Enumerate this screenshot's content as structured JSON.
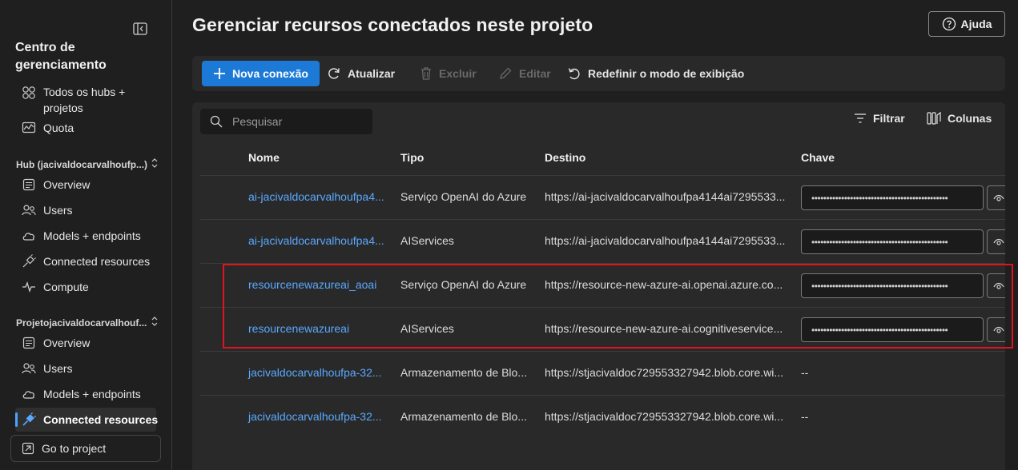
{
  "sidebar": {
    "title": "Centro de gerenciamento",
    "top_items": [
      {
        "label": "Todos os hubs + projetos",
        "icon": "grid-icon"
      },
      {
        "label": "Quota",
        "icon": "quota-icon"
      }
    ],
    "hub_group": {
      "label": "Hub (jacivaldocarvalhoufp...)",
      "items": [
        {
          "label": "Overview",
          "icon": "overview-icon"
        },
        {
          "label": "Users",
          "icon": "users-icon"
        },
        {
          "label": "Models + endpoints",
          "icon": "cloud-icon"
        },
        {
          "label": "Connected resources",
          "icon": "plug-icon"
        },
        {
          "label": "Compute",
          "icon": "pulse-icon"
        }
      ]
    },
    "project_group": {
      "label": "Projetojacivaldocarvalhouf...",
      "items": [
        {
          "label": "Overview",
          "icon": "overview-icon"
        },
        {
          "label": "Users",
          "icon": "users-icon"
        },
        {
          "label": "Models + endpoints",
          "icon": "cloud-icon"
        },
        {
          "label": "Connected resources",
          "icon": "plug-icon",
          "active": true
        }
      ]
    },
    "go_to_project": "Go to project"
  },
  "header": {
    "title": "Gerenciar recursos conectados neste projeto",
    "help": "Ajuda"
  },
  "toolbar": {
    "new_connection": "Nova conexão",
    "refresh": "Atualizar",
    "delete": "Excluir",
    "edit": "Editar",
    "reset_view": "Redefinir o modo de exibição"
  },
  "grid": {
    "search_placeholder": "Pesquisar",
    "filter": "Filtrar",
    "columns_btn": "Colunas",
    "columns": [
      "Nome",
      "Tipo",
      "Destino",
      "Chave"
    ],
    "rows": [
      {
        "name": "ai-jacivaldocarvalhoufpa4...",
        "type": "Serviço OpenAI do Azure",
        "target": "https://ai-jacivaldocarvalhoufpa4144ai7295533...",
        "key": "••••••••••••••••••••••••••••••••••••••••••••••",
        "has_key": true
      },
      {
        "name": "ai-jacivaldocarvalhoufpa4...",
        "type": "AIServices",
        "target": "https://ai-jacivaldocarvalhoufpa4144ai7295533...",
        "key": "••••••••••••••••••••••••••••••••••••••••••••••",
        "has_key": true
      },
      {
        "name": "resourcenewazureai_aoai",
        "type": "Serviço OpenAI do Azure",
        "target": "https://resource-new-azure-ai.openai.azure.co...",
        "key": "••••••••••••••••••••••••••••••••••••••••••••••",
        "has_key": true
      },
      {
        "name": "resourcenewazureai",
        "type": "AIServices",
        "target": "https://resource-new-azure-ai.cognitiveservice...",
        "key": "••••••••••••••••••••••••••••••••••••••••••••••",
        "has_key": true
      },
      {
        "name": "jacivaldocarvalhoufpa-32...",
        "type": "Armazenamento de Blo...",
        "target": "https://stjacivaldoc729553327942.blob.core.wi...",
        "key": "--",
        "has_key": false
      },
      {
        "name": "jacivaldocarvalhoufpa-32...",
        "type": "Armazenamento de Blo...",
        "target": "https://stjacivaldoc729553327942.blob.core.wi...",
        "key": "--",
        "has_key": false
      }
    ]
  },
  "colors": {
    "accent": "#1c7ad6",
    "link": "#5aa9ff",
    "highlight": "#e0141e"
  }
}
